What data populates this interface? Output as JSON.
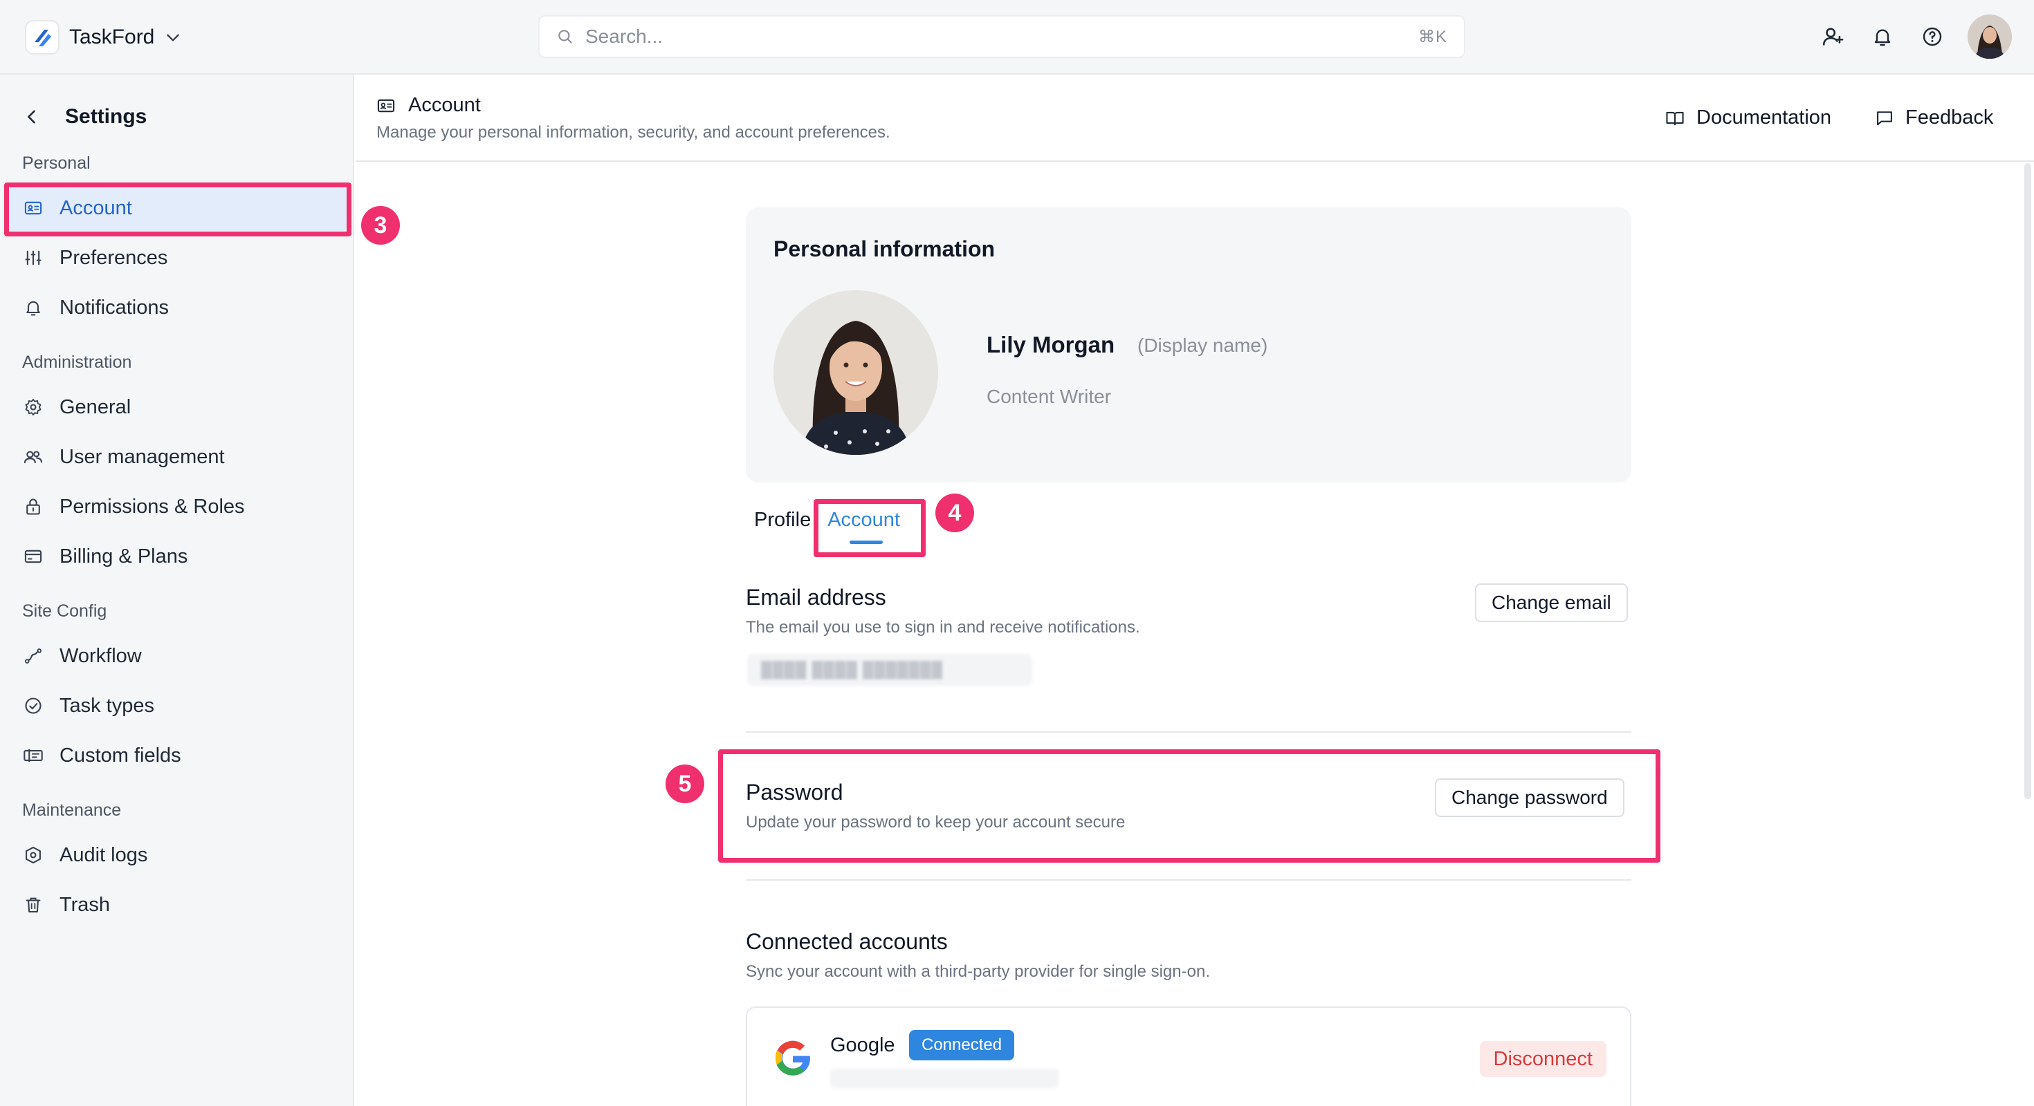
{
  "brand": {
    "name": "TaskFord",
    "color": "#2563c9"
  },
  "search": {
    "placeholder": "Search...",
    "shortcut": "⌘K"
  },
  "topbar": {
    "icons": [
      "user-add-icon",
      "bell-icon",
      "help-icon",
      "avatar"
    ]
  },
  "sidebar": {
    "title": "Settings",
    "sections": [
      {
        "label": "Personal",
        "items": [
          {
            "label": "Account",
            "icon": "id-card-icon",
            "active": true
          },
          {
            "label": "Preferences",
            "icon": "sliders-icon"
          },
          {
            "label": "Notifications",
            "icon": "bell-icon"
          }
        ]
      },
      {
        "label": "Administration",
        "items": [
          {
            "label": "General",
            "icon": "gear-icon"
          },
          {
            "label": "User management",
            "icon": "users-icon"
          },
          {
            "label": "Permissions & Roles",
            "icon": "lock-icon"
          },
          {
            "label": "Billing & Plans",
            "icon": "credit-card-icon"
          }
        ]
      },
      {
        "label": "Site Config",
        "items": [
          {
            "label": "Workflow",
            "icon": "workflow-icon"
          },
          {
            "label": "Task types",
            "icon": "check-circle-icon"
          },
          {
            "label": "Custom fields",
            "icon": "fields-icon"
          }
        ]
      },
      {
        "label": "Maintenance",
        "items": [
          {
            "label": "Audit logs",
            "icon": "shield-icon"
          },
          {
            "label": "Trash",
            "icon": "trash-icon"
          }
        ]
      }
    ]
  },
  "header": {
    "title": "Account",
    "subtitle": "Manage your personal information, security, and account preferences.",
    "documentation": "Documentation",
    "feedback": "Feedback"
  },
  "personal": {
    "title": "Personal information",
    "name": "Lily Morgan",
    "display_hint": "(Display name)",
    "role": "Content Writer"
  },
  "tabs": [
    {
      "label": "Profile",
      "active": false
    },
    {
      "label": "Account",
      "active": true
    }
  ],
  "email": {
    "title": "Email address",
    "desc": "The email you use to sign in and receive notifications.",
    "button": "Change email"
  },
  "password": {
    "title": "Password",
    "desc": "Update your password to keep your account secure",
    "button": "Change password"
  },
  "connected": {
    "title": "Connected accounts",
    "desc": "Sync your account with a third-party provider for single sign-on.",
    "provider": "Google",
    "status": "Connected",
    "disconnect": "Disconnect"
  },
  "annotations": {
    "step3": "3",
    "step4": "4",
    "step5": "5",
    "color": "#f0306e"
  },
  "colors": {
    "accent": "#2f86de",
    "active_bg": "#e2ecfb",
    "danger": "#d63b3b"
  }
}
